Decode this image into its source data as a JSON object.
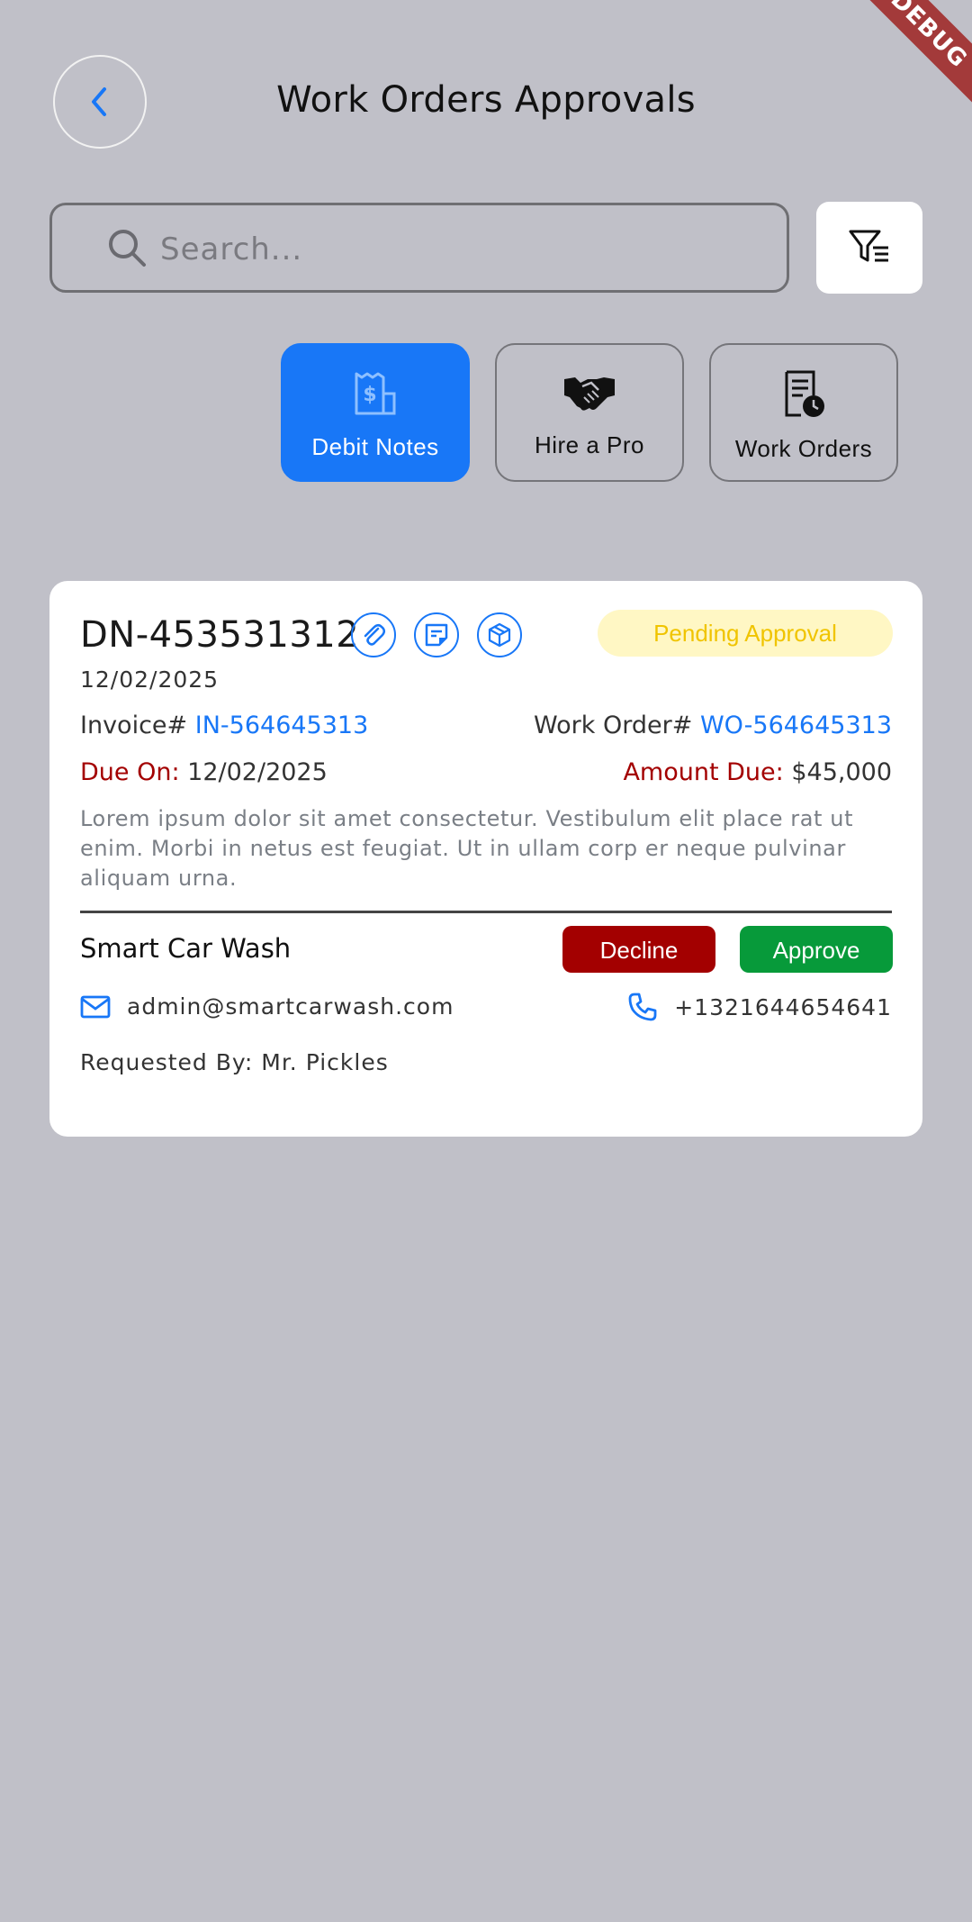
{
  "debug_banner": "DEBUG",
  "header": {
    "title": "Work Orders Approvals"
  },
  "search": {
    "placeholder": "Search..."
  },
  "tabs": [
    {
      "label": "Debit Notes",
      "icon": "receipt-dollar-icon",
      "active": true
    },
    {
      "label": "Hire a Pro",
      "icon": "handshake-icon",
      "active": false
    },
    {
      "label": "Work Orders",
      "icon": "document-clock-icon",
      "active": false
    }
  ],
  "card": {
    "id": "DN-453531312",
    "status": "Pending Approval",
    "date": "12/02/2025",
    "invoice_label": "Invoice#",
    "invoice_value": "IN-564645313",
    "work_order_label": "Work Order#",
    "work_order_value": "WO-564645313",
    "due_label": "Due On:",
    "due_value": "12/02/2025",
    "amount_label": "Amount Due:",
    "amount_value": "$45,000",
    "description": "Lorem ipsum dolor sit amet consectetur. Vestibulum elit place rat ut enim. Morbi in netus est feugiat. Ut in ullam corp er neque pulvinar aliquam urna.",
    "company": "Smart Car Wash",
    "decline_label": "Decline",
    "approve_label": "Approve",
    "email": "admin@smartcarwash.com",
    "phone": "+1321644654641",
    "requested_by": "Requested By: Mr. Pickles"
  },
  "colors": {
    "accent": "#1877f7",
    "decline": "#a30000",
    "approve": "#079a3a",
    "pending": "#f0c400"
  }
}
